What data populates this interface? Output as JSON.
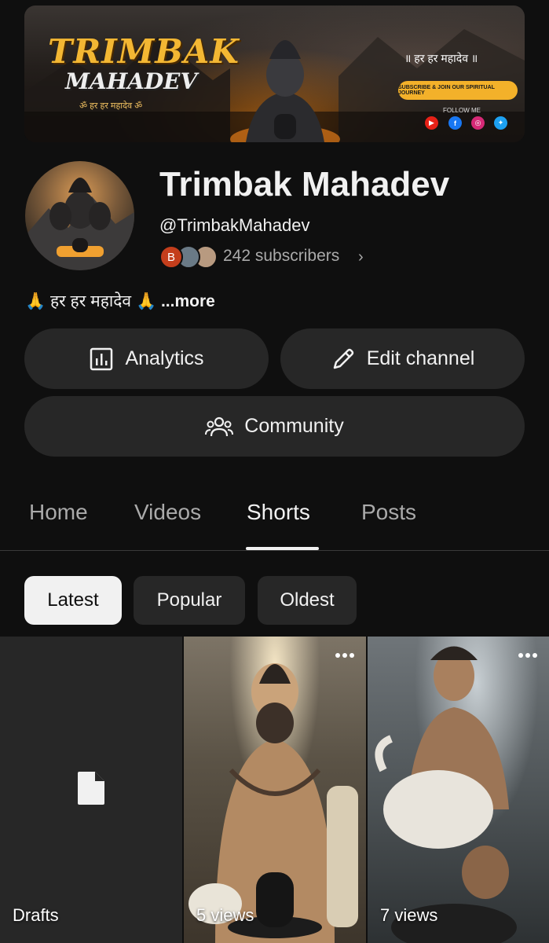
{
  "banner": {
    "title_line1": "TRIMBAK",
    "title_line2": "MAHADEV",
    "subtitle": "ॐ हर हर महादेव ॐ",
    "right_text": "॥ हर हर महादेव ॥",
    "cta": "SUBSCRIBE & JOIN OUR SPIRITUAL JOURNEY",
    "follow": "FOLLOW ME"
  },
  "channel": {
    "name": "Trimbak Mahadev",
    "handle": "@TrimbakMahadev",
    "subscriber_initial": "B",
    "subscribers": "242 subscribers",
    "description": "🙏 हर हर महादेव 🙏",
    "more": "...more"
  },
  "buttons": {
    "analytics": "Analytics",
    "edit_channel": "Edit channel",
    "community": "Community"
  },
  "tabs": [
    {
      "label": "Home",
      "active": false
    },
    {
      "label": "Videos",
      "active": false
    },
    {
      "label": "Shorts",
      "active": true
    },
    {
      "label": "Posts",
      "active": false
    }
  ],
  "chips": [
    {
      "label": "Latest",
      "active": true
    },
    {
      "label": "Popular",
      "active": false
    },
    {
      "label": "Oldest",
      "active": false
    }
  ],
  "grid": [
    {
      "label": "Drafts",
      "icon": "document-icon"
    },
    {
      "label": "5 views"
    },
    {
      "label": "7 views"
    }
  ],
  "colors": {
    "background": "#0f0f0f",
    "surface": "#272727",
    "text_primary": "#f1f1f1",
    "text_secondary": "#aaaaaa",
    "accent_gold": "#f3b733"
  }
}
